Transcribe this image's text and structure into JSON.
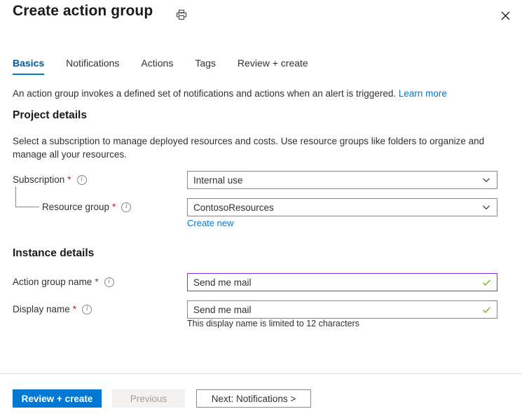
{
  "header": {
    "title": "Create action group",
    "print_icon": "printer-icon",
    "close_icon": "close-icon"
  },
  "tabs": [
    {
      "label": "Basics",
      "active": true
    },
    {
      "label": "Notifications",
      "active": false
    },
    {
      "label": "Actions",
      "active": false
    },
    {
      "label": "Tags",
      "active": false
    },
    {
      "label": "Review + create",
      "active": false
    }
  ],
  "description": {
    "text": "An action group invokes a defined set of notifications and actions when an alert is triggered.",
    "link": "Learn more"
  },
  "project_details": {
    "heading": "Project details",
    "subtext": "Select a subscription to manage deployed resources and costs. Use resource groups like folders to organize and manage all your resources.",
    "subscription": {
      "label": "Subscription",
      "required": "*",
      "value": "Internal use",
      "info_icon": "info-icon",
      "chevron_icon": "chevron-down-icon"
    },
    "resource_group": {
      "label": "Resource group",
      "required": "*",
      "value": "ContosoResources",
      "info_icon": "info-icon",
      "chevron_icon": "chevron-down-icon",
      "create_new_link": "Create new"
    }
  },
  "instance_details": {
    "heading": "Instance details",
    "action_group_name": {
      "label": "Action group name",
      "required": "*",
      "value": "Send me mail",
      "placeholder": "",
      "info_icon": "info-icon",
      "valid_icon": "checkmark-icon",
      "focused": true
    },
    "display_name": {
      "label": "Display name",
      "required": "*",
      "value": "Send me mail",
      "placeholder": "",
      "info_icon": "info-icon",
      "valid_icon": "checkmark-icon",
      "helper_text": "This display name is limited to 12 characters"
    }
  },
  "footer": {
    "review_create": "Review + create",
    "previous": "Previous",
    "next": "Next: Notifications >"
  },
  "colors": {
    "accent": "#0078d4",
    "required_asterisk": "#a4262c",
    "valid_check": "#6bb700",
    "focused_border": "#8a2be2",
    "border": "#8a8886",
    "disabled_bg": "#f3f2f1"
  }
}
